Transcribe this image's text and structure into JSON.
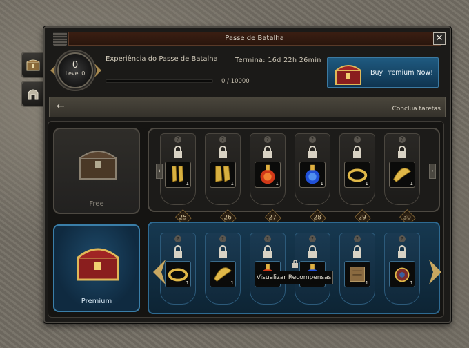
{
  "sidebar": {
    "tabs": [
      {
        "icon": "treasure-chest-icon"
      },
      {
        "icon": "helmet-icon"
      }
    ]
  },
  "window": {
    "title": "Passe de Batalha",
    "close_label": "✕"
  },
  "header": {
    "level_value": "0",
    "level_label": "Level 0",
    "experience_title": "Experiência do Passe de Batalha",
    "terminates_text": "Termina:  16d 22h 26min",
    "progress_text": "0 / 10000",
    "progress_fraction": 0,
    "premium_button_label": "Buy Premium Now!"
  },
  "taskbar": {
    "back_icon": "back-arrow-icon",
    "task_text": "Conclua tarefas"
  },
  "free_card": {
    "label": "Free"
  },
  "premium_card": {
    "label": "Premium"
  },
  "levels": [
    "25",
    "26",
    "27",
    "28",
    "29",
    "30"
  ],
  "free_rewards": [
    {
      "icon": "gold-gloves-icon",
      "qty": "1"
    },
    {
      "icon": "gold-boots-icon",
      "qty": "1"
    },
    {
      "icon": "red-potion-icon",
      "qty": "1"
    },
    {
      "icon": "blue-potion-icon",
      "qty": "1"
    },
    {
      "icon": "gold-ring-icon",
      "qty": "1"
    },
    {
      "icon": "gold-bracelet-icon",
      "qty": "1"
    }
  ],
  "premium_rewards": [
    {
      "icon": "gold-ring-icon",
      "qty": "1"
    },
    {
      "icon": "gold-bracelet-icon",
      "qty": "1"
    },
    {
      "icon": "red-potion-icon",
      "qty": "1"
    },
    {
      "icon": "blue-potion-icon",
      "qty": "1"
    },
    {
      "icon": "scroll-icon",
      "qty": "1"
    },
    {
      "icon": "amulet-icon",
      "qty": "1"
    }
  ],
  "tooltip": {
    "text": "Visualizar Recompensas"
  },
  "colors": {
    "title_bar": "#3a1e12",
    "premium_accent": "#1f5a80",
    "gold": "#c9a14a",
    "panel_dark": "#1b1a18"
  }
}
